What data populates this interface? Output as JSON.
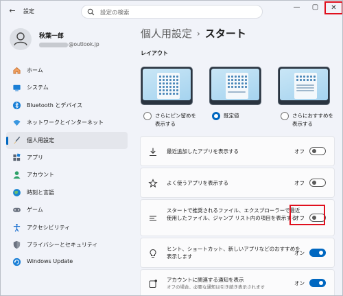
{
  "window": {
    "title": "設定",
    "minimize": "—",
    "maximize": "▢",
    "close": "✕"
  },
  "search": {
    "placeholder": "設定の検索"
  },
  "profile": {
    "name": "秋葉一郎",
    "email_suffix": "@outlook.jp"
  },
  "sidebar": {
    "items": [
      {
        "label": "ホーム",
        "icon": "home-icon",
        "color": "#e8782d"
      },
      {
        "label": "システム",
        "icon": "system-icon",
        "color": "#0078d4"
      },
      {
        "label": "Bluetooth とデバイス",
        "icon": "bluetooth-icon",
        "color": "#0078d4"
      },
      {
        "label": "ネットワークとインターネット",
        "icon": "wifi-icon",
        "color": "#2b88d8"
      },
      {
        "label": "個人用設定",
        "icon": "brush-icon",
        "color": "#d08b25"
      },
      {
        "label": "アプリ",
        "icon": "apps-icon",
        "color": "#5b6472"
      },
      {
        "label": "アカウント",
        "icon": "account-icon",
        "color": "#2da168"
      },
      {
        "label": "時刻と言語",
        "icon": "globe-clock-icon",
        "color": "#1a86d0"
      },
      {
        "label": "ゲーム",
        "icon": "gamepad-icon",
        "color": "#6b7280"
      },
      {
        "label": "アクセシビリティ",
        "icon": "accessibility-icon",
        "color": "#1a6fd0"
      },
      {
        "label": "プライバシーとセキュリティ",
        "icon": "shield-icon",
        "color": "#6b7280"
      },
      {
        "label": "Windows Update",
        "icon": "update-icon",
        "color": "#0078d4"
      }
    ],
    "active_index": 4
  },
  "main": {
    "breadcrumb_parent": "個人用設定",
    "breadcrumb_sep": "›",
    "breadcrumb_current": "スタート",
    "layout_heading": "レイアウト",
    "layout_options": [
      {
        "line1": "さらにピン留めを",
        "line2": "表示する",
        "selected": false
      },
      {
        "line1": "既定値",
        "line2": "",
        "selected": true
      },
      {
        "line1": "さらにおすすめを",
        "line2": "表示する",
        "selected": false
      }
    ],
    "settings": [
      {
        "icon": "download-icon",
        "line1": "最近追加したアプリを表示する",
        "line2": "",
        "sub": "",
        "state": "オフ",
        "on": false
      },
      {
        "icon": "star-icon",
        "line1": "よく使うアプリを表示する",
        "line2": "",
        "sub": "",
        "state": "オフ",
        "on": false
      },
      {
        "icon": "list-icon",
        "line1": "スタートで推奨されるファイル、エクスプローラーで最近",
        "line2": "使用したファイル、ジャンプ リスト内の項目を表示する",
        "sub": "",
        "state": "オフ",
        "on": false
      },
      {
        "icon": "lightbulb-icon",
        "line1": "ヒント、ショートカット、新しいアプリなどのおすすめを",
        "line2": "表示します",
        "sub": "",
        "state": "オン",
        "on": true
      },
      {
        "icon": "notification-icon",
        "line1": "アカウントに関連する通知を表示",
        "line2": "",
        "sub": "オフの場合、必要な通知は引き続き表示されます",
        "state": "オン",
        "on": true
      }
    ]
  },
  "colors": {
    "accent": "#0067c0",
    "highlight": "#e0101e"
  }
}
